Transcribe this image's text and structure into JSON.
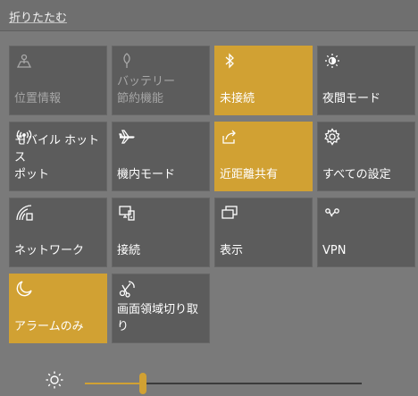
{
  "header": {
    "collapse_label": "折りたたむ"
  },
  "colors": {
    "accent": "#d1a133",
    "tile_off": "#5c5c5c",
    "background": "#7a7a7a"
  },
  "tiles": [
    {
      "label": "位置情報",
      "icon": "location-icon",
      "state": "disabled"
    },
    {
      "label": "バッテリー\n節約機能",
      "icon": "battery-saver-icon",
      "state": "disabled"
    },
    {
      "label": "未接続",
      "icon": "bluetooth-icon",
      "state": "on"
    },
    {
      "label": "夜間モード",
      "icon": "night-light-icon",
      "state": "off"
    },
    {
      "label": "モバイル ホットス\nポット",
      "icon": "mobile-hotspot-icon",
      "state": "off"
    },
    {
      "label": "機内モード",
      "icon": "airplane-icon",
      "state": "off"
    },
    {
      "label": "近距離共有",
      "icon": "nearby-share-icon",
      "state": "on"
    },
    {
      "label": "すべての設定",
      "icon": "gear-icon",
      "state": "off"
    },
    {
      "label": "ネットワーク",
      "icon": "network-icon",
      "state": "off"
    },
    {
      "label": "接続",
      "icon": "connect-icon",
      "state": "off"
    },
    {
      "label": "表示",
      "icon": "project-icon",
      "state": "off"
    },
    {
      "label": "VPN",
      "icon": "vpn-icon",
      "state": "off"
    },
    {
      "label": "アラームのみ",
      "icon": "moon-icon",
      "state": "on"
    },
    {
      "label": "画面領域切り取\nり",
      "icon": "snip-icon",
      "state": "off"
    }
  ],
  "brightness": {
    "icon": "sun-icon",
    "value_fraction": 0.21
  }
}
